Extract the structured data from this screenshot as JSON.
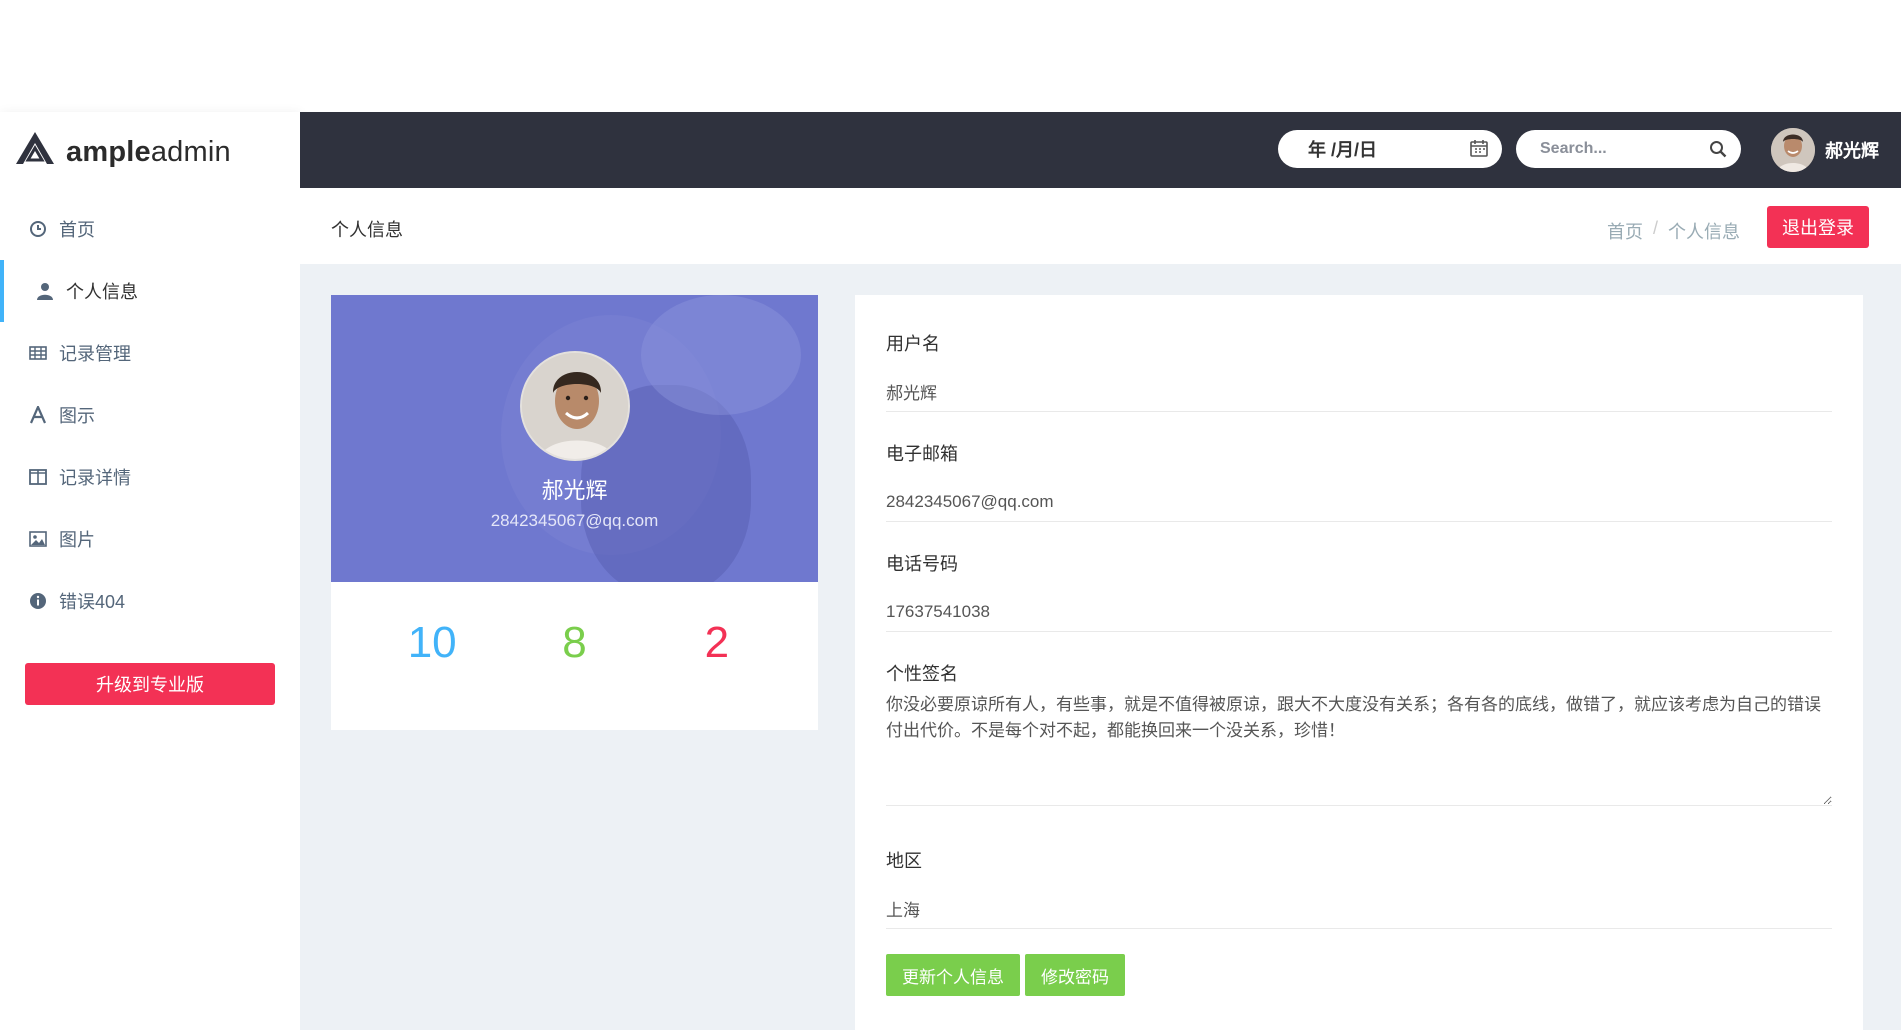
{
  "app": {
    "logo_bold": "ample",
    "logo_light": "admin"
  },
  "sidebar": {
    "items": [
      {
        "label": "首页",
        "icon": "clock-icon",
        "active": false
      },
      {
        "label": "个人信息",
        "icon": "user-icon",
        "active": true
      },
      {
        "label": "记录管理",
        "icon": "table-icon",
        "active": false
      },
      {
        "label": "图示",
        "icon": "font-icon",
        "active": false
      },
      {
        "label": "记录详情",
        "icon": "columns-icon",
        "active": false
      },
      {
        "label": "图片",
        "icon": "image-icon",
        "active": false
      },
      {
        "label": "错误404",
        "icon": "info-icon",
        "active": false
      }
    ],
    "upgrade_label": "升级到专业版"
  },
  "topbar": {
    "date_value": "年 /月/日",
    "search_placeholder": "Search...",
    "user_name": "郝光辉"
  },
  "titlebar": {
    "title": "个人信息",
    "breadcrumb": [
      "首页",
      "个人信息"
    ],
    "breadcrumb_sep": "/",
    "logout_label": "退出登录"
  },
  "profile": {
    "name": "郝光辉",
    "email": "2842345067@qq.com",
    "stats": [
      "10",
      "8",
      "2"
    ]
  },
  "form": {
    "username_label": "用户名",
    "username_value": "郝光辉",
    "email_label": "电子邮箱",
    "email_value": "2842345067@qq.com",
    "phone_label": "电话号码",
    "phone_value": "17637541038",
    "signature_label": "个性签名",
    "signature_value": "你没必要原谅所有人，有些事，就是不值得被原谅，跟大不大度没有关系；各有各的底线，做错了，就应该考虑为自己的错误付出代价。不是每个对不起，都能换回来一个没关系，珍惜！",
    "region_label": "地区",
    "region_value": "上海",
    "update_label": "更新个人信息",
    "password_label": "修改密码"
  },
  "colors": {
    "topbar": "#2f323e",
    "accent_red": "#f33155",
    "accent_green": "#7ace4c",
    "accent_blue": "#41b3f9",
    "profile_bg": "#6f78cf",
    "content_bg": "#edf1f5"
  }
}
